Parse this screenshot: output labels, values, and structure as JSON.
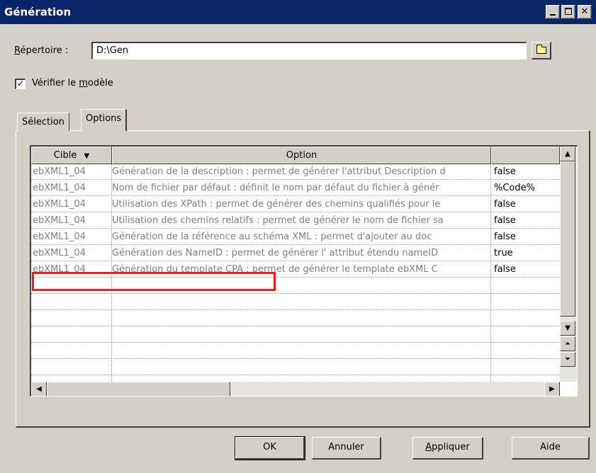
{
  "window": {
    "title": "Génération"
  },
  "directory": {
    "label_accel": "R",
    "label_rest": "épertoire :",
    "value": "D:\\Gen"
  },
  "verify": {
    "checked_glyph": "✓",
    "label_pre": "Vérifier le ",
    "label_accel": "m",
    "label_post": "odèle"
  },
  "tabs": [
    {
      "label": "Sélection"
    },
    {
      "label": "Options"
    }
  ],
  "grid": {
    "headers": {
      "cible": "Cible",
      "option": "Option"
    },
    "rows": [
      {
        "cible": "ebXML1_04",
        "option": "Génération de la description : permet de générer l'attribut Description d",
        "value": "false"
      },
      {
        "cible": "ebXML1_04",
        "option": "Nom de fichier par défaut : définit le nom par défaut du fichier à génér",
        "value": "%Code%"
      },
      {
        "cible": "ebXML1_04",
        "option": "Utilisation des XPath : permet de générer des chemins qualifiés pour le",
        "value": "false"
      },
      {
        "cible": "ebXML1_04",
        "option": "Utilisation des chemins relatifs : permet de générer le nom de fichier sa",
        "value": "false"
      },
      {
        "cible": "ebXML1_04",
        "option": "Génération de la référence au schéma XML : permet d'ajouter au doc",
        "value": "false"
      },
      {
        "cible": "ebXML1_04",
        "option": "Génération des NameID : permet de générer l' attribut étendu nameID",
        "value": "true"
      },
      {
        "cible": "ebXML1_04",
        "option": "Génération du template CPA : permet de générer le template ebXML C",
        "value": "false"
      }
    ]
  },
  "buttons": {
    "ok": "OK",
    "cancel": "Annuler",
    "apply_accel": "A",
    "apply_rest": "ppliquer",
    "help": "Aide"
  },
  "colors": {
    "titlebar": "#0a246a",
    "highlight": "#e8221a",
    "face": "#d4d0c8"
  }
}
